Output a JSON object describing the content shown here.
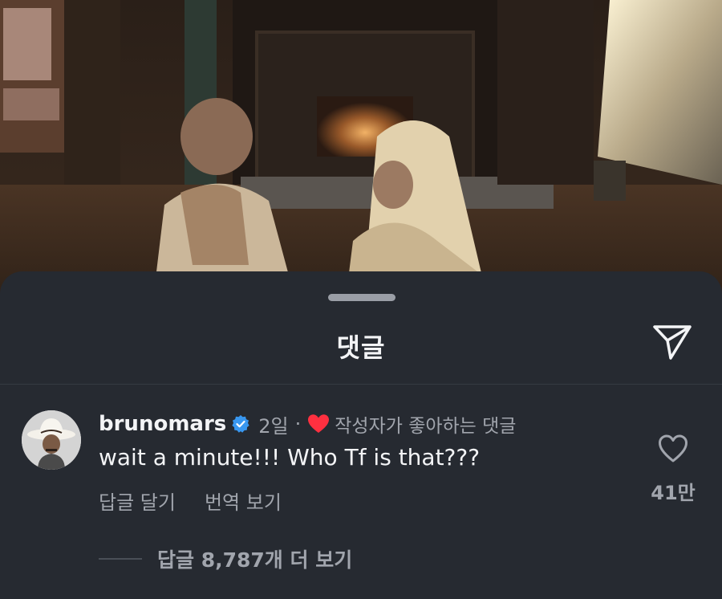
{
  "sheet": {
    "title": "댓글",
    "share_icon": "paper-plane-icon"
  },
  "comment": {
    "username": "brunomars",
    "verified_icon": "verified-badge-icon",
    "time": "2일",
    "separator": "·",
    "liked_by_author_icon": "red-heart-icon",
    "liked_by_author_label": "작성자가 좋아하는 댓글",
    "text": "wait a minute!!! Who Tf is that???",
    "reply_label": "답글 달기",
    "translate_label": "번역 보기",
    "like_icon": "heart-outline-icon",
    "like_count": "41만",
    "view_replies_label": "답글 8,787개 더 보기"
  },
  "colors": {
    "sheet_bg": "#262a31",
    "primary_text": "#f3f4f6",
    "secondary_text": "#a1a5ad",
    "verified_blue": "#3897f0",
    "heart_red": "#ff3040"
  }
}
